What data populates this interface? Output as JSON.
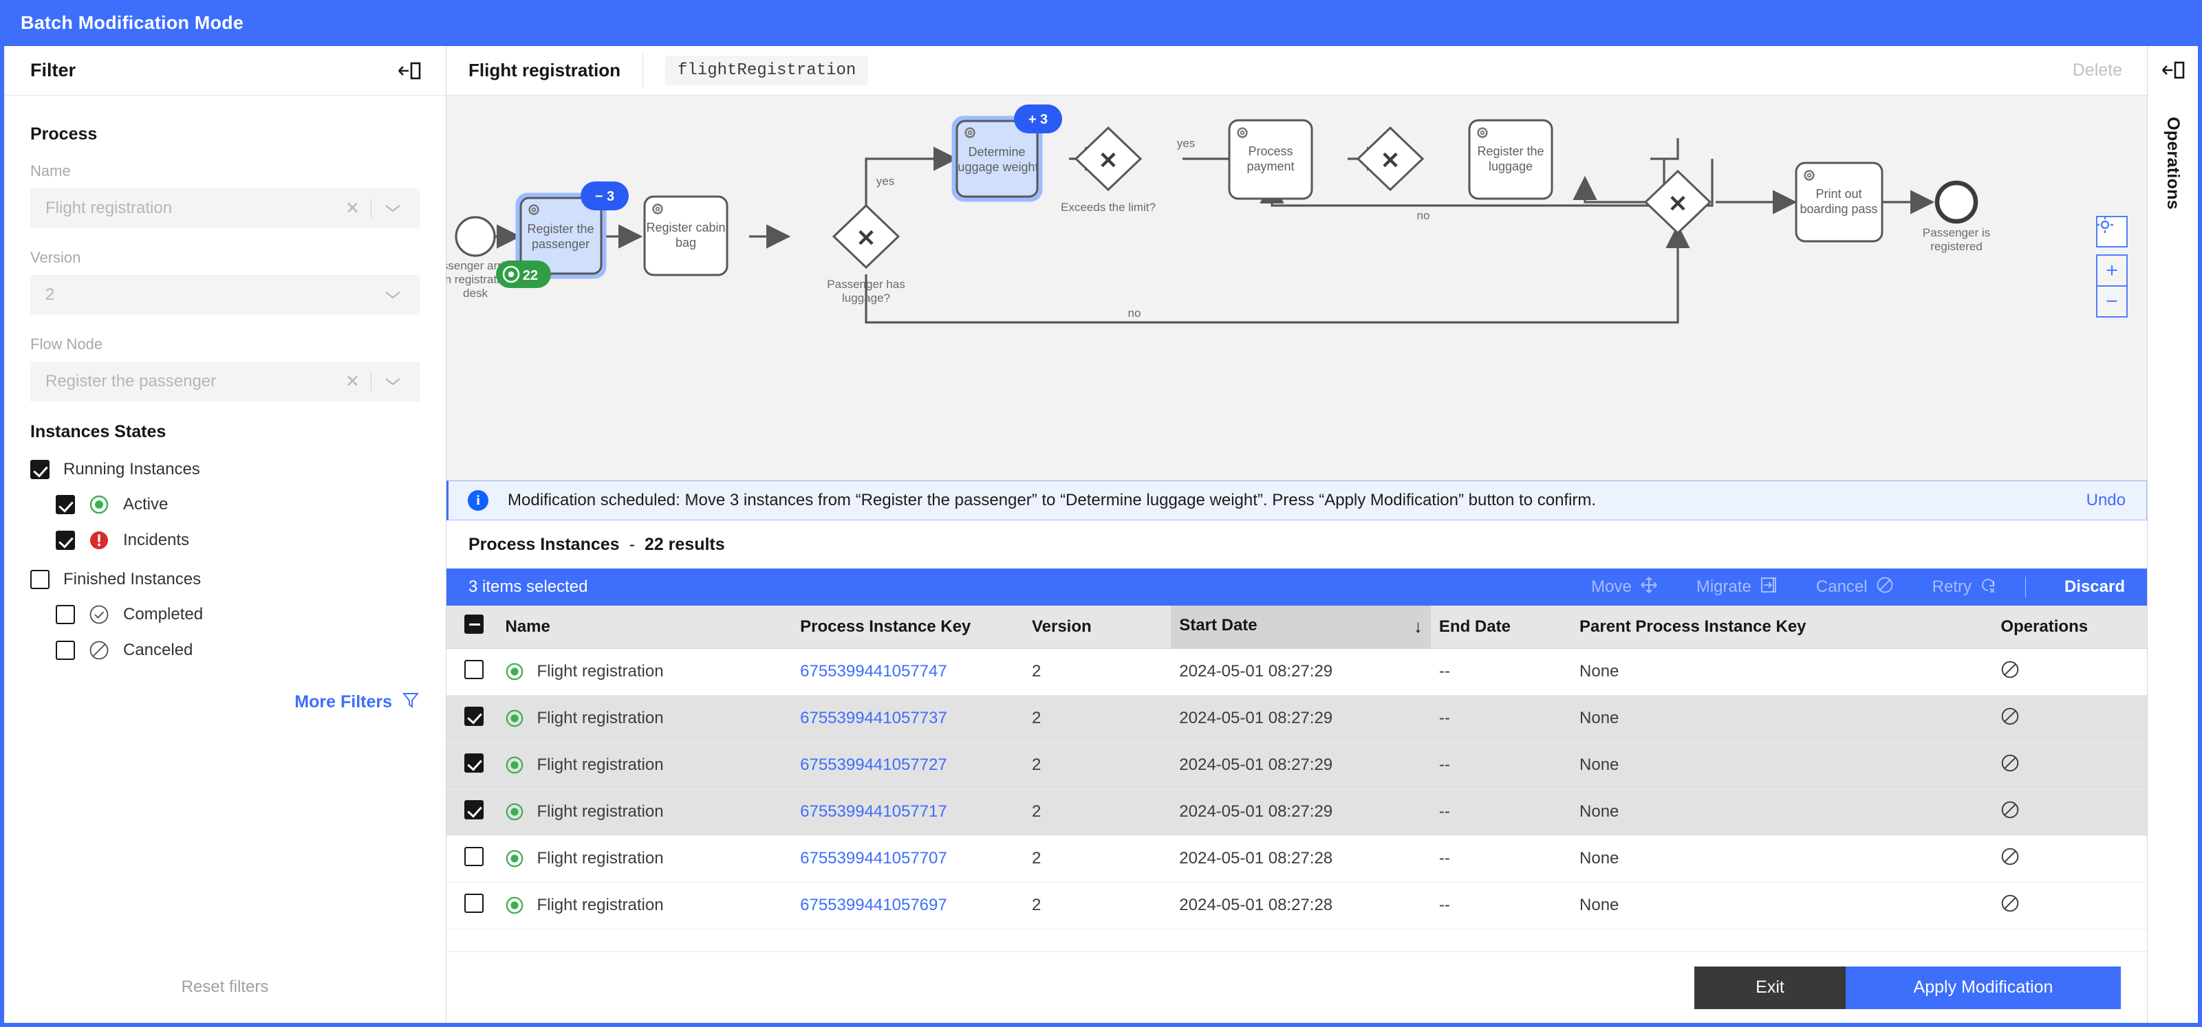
{
  "banner": {
    "title": "Batch Modification Mode"
  },
  "filter_panel": {
    "heading": "Filter",
    "collapse_icon": "panel-collapse-icon",
    "process_section_title": "Process",
    "fields": [
      {
        "label": "Name",
        "value": "Flight registration",
        "clearable": true
      },
      {
        "label": "Version",
        "value": "2",
        "clearable": false
      },
      {
        "label": "Flow Node",
        "value": "Register the passenger",
        "clearable": true
      }
    ],
    "states_title": "Instances States",
    "states": [
      {
        "label": "Running Instances",
        "checked": true,
        "indent": false,
        "icon": ""
      },
      {
        "label": "Active",
        "checked": true,
        "indent": true,
        "icon": "active-icon"
      },
      {
        "label": "Incidents",
        "checked": true,
        "indent": true,
        "icon": "incident-icon"
      },
      {
        "label": "Finished Instances",
        "checked": false,
        "indent": false,
        "icon": ""
      },
      {
        "label": "Completed",
        "checked": false,
        "indent": true,
        "icon": "completed-icon"
      },
      {
        "label": "Canceled",
        "checked": false,
        "indent": true,
        "icon": "canceled-icon"
      }
    ],
    "more_filters_label": "More Filters",
    "reset_filters_label": "Reset filters"
  },
  "main_header": {
    "process_name": "Flight registration",
    "process_id": "flightRegistration",
    "delete_label": "Delete"
  },
  "diagram": {
    "nodes": [
      {
        "id": "start",
        "type": "start-event",
        "label": "Passenger arrived on registration desk"
      },
      {
        "id": "register",
        "type": "service-task",
        "label": "Register the passenger",
        "selected": true,
        "badge_blue": "− 3",
        "badge_green": "22"
      },
      {
        "id": "cabin",
        "type": "service-task",
        "label": "Register cabin bag"
      },
      {
        "id": "gw1",
        "type": "gateway",
        "label": "Passenger has luggage?"
      },
      {
        "id": "weight",
        "type": "service-task",
        "label": "Determine luggage weight",
        "selected": true,
        "badge_blue": "+ 3"
      },
      {
        "id": "gw2",
        "type": "gateway",
        "label": "Exceeds the limit?"
      },
      {
        "id": "payment",
        "type": "service-task",
        "label": "Process payment"
      },
      {
        "id": "gw3",
        "type": "gateway",
        "label": ""
      },
      {
        "id": "luggage",
        "type": "service-task",
        "label": "Register the luggage"
      },
      {
        "id": "gw4",
        "type": "gateway",
        "label": ""
      },
      {
        "id": "boarding",
        "type": "service-task",
        "label": "Print out boarding pass"
      },
      {
        "id": "end",
        "type": "end-event",
        "label": "Passenger is registered"
      }
    ],
    "edge_labels": {
      "yes1": "yes",
      "yes2": "yes",
      "no1": "no",
      "no2": "no"
    },
    "zoom_controls": {
      "reset": "reset-zoom-icon",
      "in": "+",
      "out": "−"
    }
  },
  "notification": {
    "icon": "info-icon",
    "message": "Modification scheduled: Move 3 instances from “Register the passenger” to “Determine luggage weight”. Press “Apply Modification” button to confirm.",
    "undo_label": "Undo"
  },
  "results": {
    "title": "Process Instances",
    "separator": "-",
    "count_label": "22 results"
  },
  "selection_bar": {
    "count_label": "3 items selected",
    "actions": [
      {
        "label": "Move",
        "icon": "move-icon",
        "enabled": false
      },
      {
        "label": "Migrate",
        "icon": "migrate-icon",
        "enabled": false
      },
      {
        "label": "Cancel",
        "icon": "cancel-icon",
        "enabled": false
      },
      {
        "label": "Retry",
        "icon": "retry-icon",
        "enabled": false
      },
      {
        "label": "Discard",
        "icon": "",
        "enabled": true
      }
    ]
  },
  "table": {
    "select_all_state": "indeterminate",
    "columns": [
      "Name",
      "Process Instance Key",
      "Version",
      "Start Date",
      "End Date",
      "Parent Process Instance Key",
      "Operations"
    ],
    "sorted_column": "Start Date",
    "sort_direction": "desc",
    "rows": [
      {
        "checked": false,
        "state": "active",
        "name": "Flight registration",
        "key": "6755399441057747",
        "version": "2",
        "start": "2024-05-01 08:27:29",
        "end": "--",
        "parent": "None",
        "op": "cancel-operation-icon"
      },
      {
        "checked": true,
        "state": "active",
        "name": "Flight registration",
        "key": "6755399441057737",
        "version": "2",
        "start": "2024-05-01 08:27:29",
        "end": "--",
        "parent": "None",
        "op": "cancel-operation-icon"
      },
      {
        "checked": true,
        "state": "active",
        "name": "Flight registration",
        "key": "6755399441057727",
        "version": "2",
        "start": "2024-05-01 08:27:29",
        "end": "--",
        "parent": "None",
        "op": "cancel-operation-icon"
      },
      {
        "checked": true,
        "state": "active",
        "name": "Flight registration",
        "key": "6755399441057717",
        "version": "2",
        "start": "2024-05-01 08:27:29",
        "end": "--",
        "parent": "None",
        "op": "cancel-operation-icon"
      },
      {
        "checked": false,
        "state": "active",
        "name": "Flight registration",
        "key": "6755399441057707",
        "version": "2",
        "start": "2024-05-01 08:27:28",
        "end": "--",
        "parent": "None",
        "op": "cancel-operation-icon"
      },
      {
        "checked": false,
        "state": "active",
        "name": "Flight registration",
        "key": "6755399441057697",
        "version": "2",
        "start": "2024-05-01 08:27:28",
        "end": "--",
        "parent": "None",
        "op": "cancel-operation-icon"
      }
    ]
  },
  "bottom_bar": {
    "exit_label": "Exit",
    "apply_label": "Apply Modification"
  },
  "ops_rail": {
    "collapse_icon": "panel-expand-icon",
    "label": "Operations"
  },
  "colors": {
    "accent": "#3d6efc",
    "active": "#3caf50",
    "incident": "#d92b2b",
    "banner": "#3d6efc",
    "selected_row": "#e2e2e2"
  }
}
